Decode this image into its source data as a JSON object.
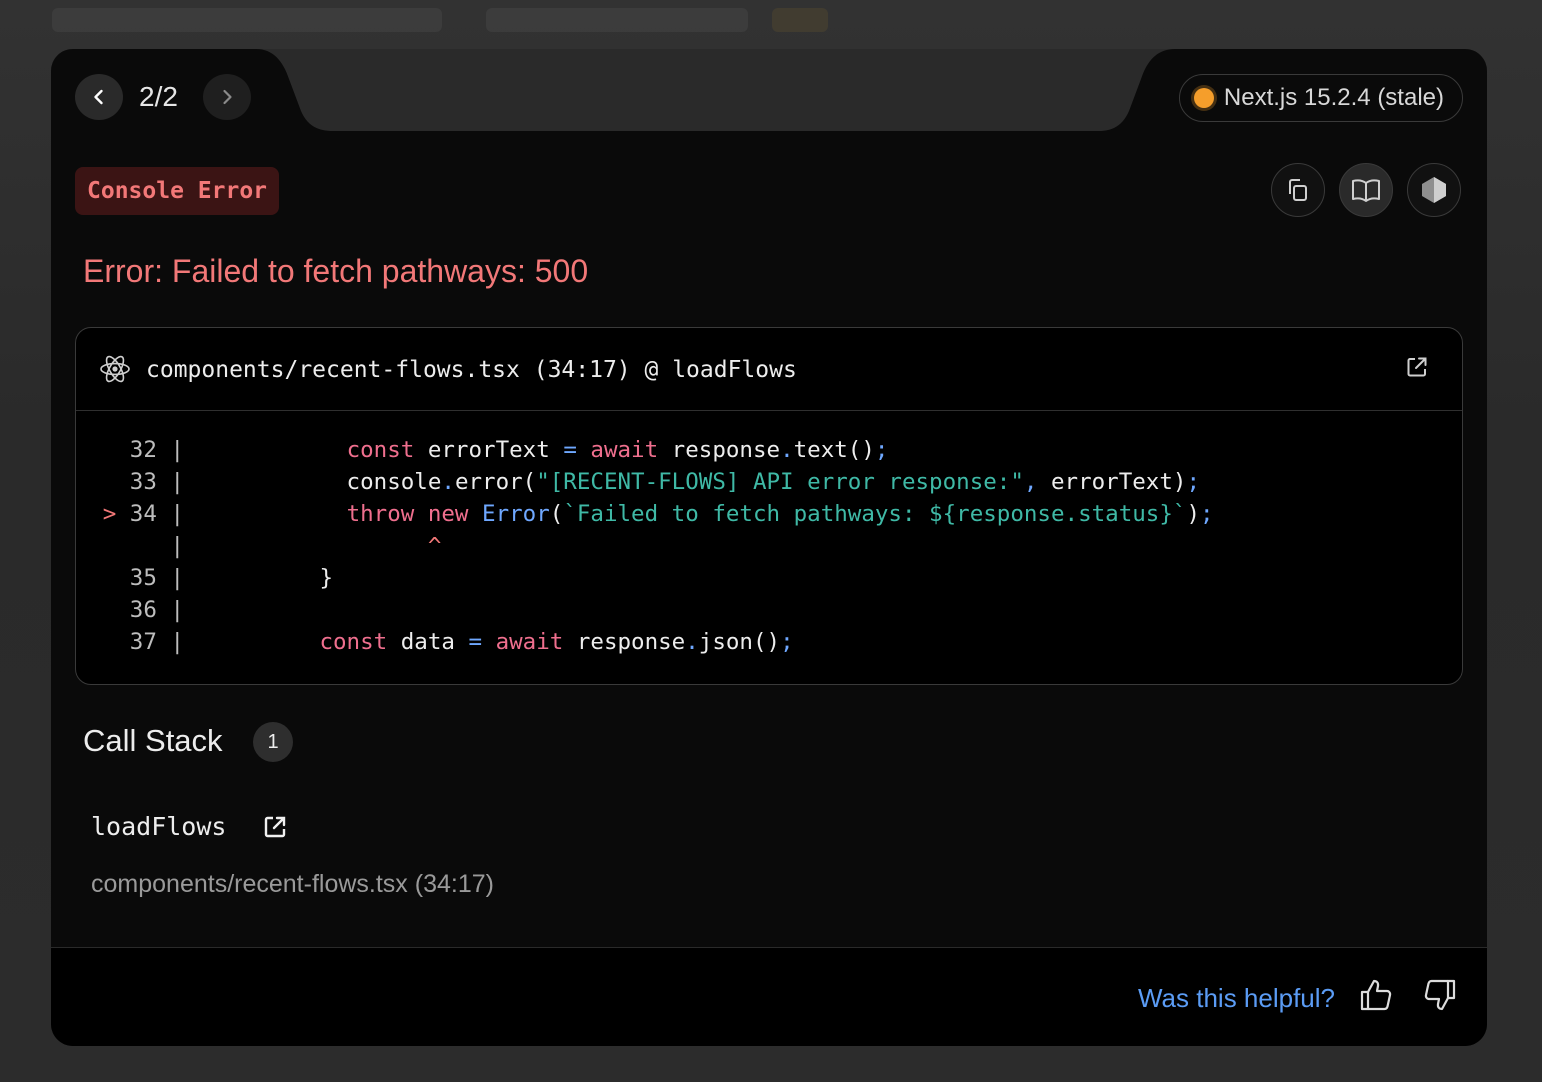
{
  "nav": {
    "counter": "2/2",
    "prev_icon": "chevron-left-icon",
    "next_icon": "chevron-right-icon"
  },
  "version": {
    "label": "Next.js 15.2.4 (stale)",
    "status_color": "#f59e2b"
  },
  "error": {
    "badge": "Console Error",
    "message": "Error: Failed to fetch pathways: 500"
  },
  "toolbar": {
    "icons": [
      "copy-icon",
      "book-icon",
      "nodejs-icon"
    ]
  },
  "code_frame": {
    "file_ref": "components/recent-flows.tsx (34:17) @ loadFlows",
    "lines": [
      {
        "gutter": "  32 |",
        "parts": [
          [
            "plain",
            "          "
          ],
          [
            "kw",
            "const"
          ],
          [
            "plain",
            " errorText "
          ],
          [
            "pt",
            "="
          ],
          [
            "plain",
            " "
          ],
          [
            "kw",
            "await"
          ],
          [
            "plain",
            " response"
          ],
          [
            "pt",
            "."
          ],
          [
            "plain",
            "text()"
          ],
          [
            "pt",
            ";"
          ]
        ]
      },
      {
        "gutter": "  33 |",
        "parts": [
          [
            "plain",
            "          console"
          ],
          [
            "pt",
            "."
          ],
          [
            "plain",
            "error("
          ],
          [
            "str",
            "\"[RECENT-FLOWS] API error response:\""
          ],
          [
            "pt",
            ","
          ],
          [
            "plain",
            " errorText)"
          ],
          [
            "pt",
            ";"
          ]
        ]
      },
      {
        "gutter": "> 34 |",
        "parts": [
          [
            "plain",
            "          "
          ],
          [
            "kw",
            "throw"
          ],
          [
            "plain",
            " "
          ],
          [
            "kw",
            "new"
          ],
          [
            "plain",
            " "
          ],
          [
            "fn",
            "Error"
          ],
          [
            "plain",
            "("
          ],
          [
            "str",
            "`Failed to fetch pathways: ${response.status}`"
          ],
          [
            "plain",
            ")"
          ],
          [
            "pt",
            ";"
          ]
        ]
      },
      {
        "gutter": "     |",
        "parts": [
          [
            "plain",
            "                "
          ],
          [
            "caret",
            "^"
          ]
        ]
      },
      {
        "gutter": "  35 |",
        "parts": [
          [
            "plain",
            "        }"
          ]
        ]
      },
      {
        "gutter": "  36 |",
        "parts": [
          [
            "plain",
            ""
          ]
        ]
      },
      {
        "gutter": "  37 |",
        "parts": [
          [
            "plain",
            "        "
          ],
          [
            "kw",
            "const"
          ],
          [
            "plain",
            " data "
          ],
          [
            "pt",
            "="
          ],
          [
            "plain",
            " "
          ],
          [
            "kw",
            "await"
          ],
          [
            "plain",
            " response"
          ],
          [
            "pt",
            "."
          ],
          [
            "plain",
            "json()"
          ],
          [
            "pt",
            ";"
          ]
        ]
      }
    ]
  },
  "call_stack": {
    "title": "Call Stack",
    "count": "1",
    "frames": [
      {
        "fn": "loadFlows",
        "file": "components/recent-flows.tsx (34:17)"
      }
    ]
  },
  "footer": {
    "helpful": "Was this helpful?"
  },
  "colors": {
    "error": "#f27878",
    "link": "#5b9cf5",
    "keyword": "#ef6f8e",
    "string": "#3fb9a6",
    "function": "#6fa8ff"
  }
}
